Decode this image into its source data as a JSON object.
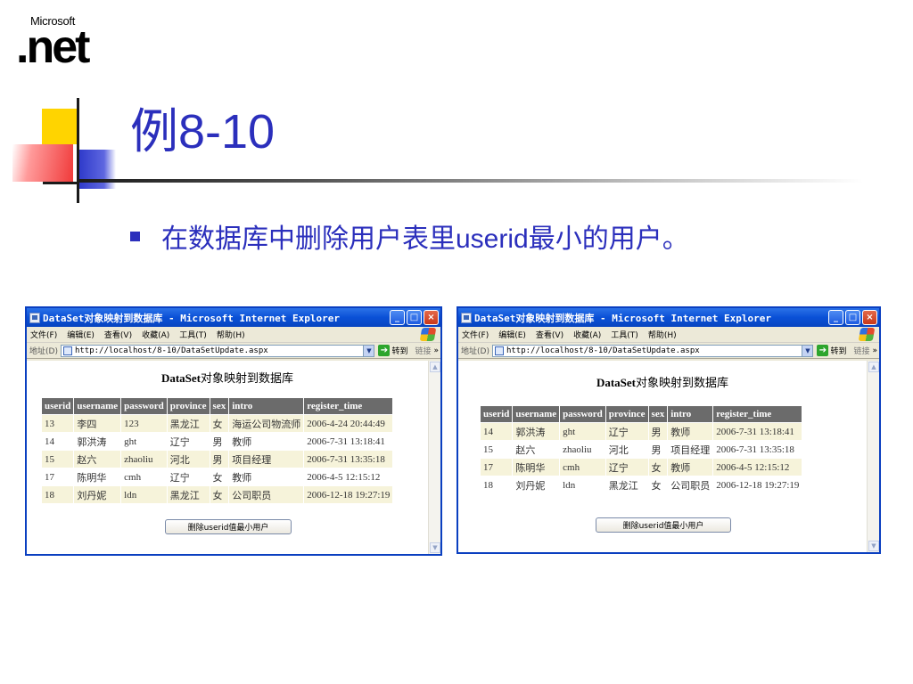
{
  "logo": {
    "company": "Microsoft",
    "product": ".net"
  },
  "slide": {
    "title": "例8-10",
    "bullet": "在数据库中删除用户表里userid最小的用户。"
  },
  "colors": {
    "title": "#2b2fbc",
    "table_header": "#6b6b6b",
    "row_alt": "#f6f3da",
    "xp_titlebar": "#0a50d6"
  },
  "browser": {
    "window_title": "DataSet对象映射到数据库 - Microsoft Internet Explorer",
    "menus": [
      "文件(F)",
      "编辑(E)",
      "查看(V)",
      "收藏(A)",
      "工具(T)",
      "帮助(H)"
    ],
    "address_label": "地址(D)",
    "url": "http://localhost/8-10/DataSetUpdate.aspx",
    "go_label": "转到",
    "links_label": "链接",
    "chevron": "»",
    "controls": {
      "minimize": "_",
      "maximize": "□",
      "close": "×"
    },
    "icons": [
      "ie-page-icon",
      "windows-logo-icon",
      "go-arrow-icon",
      "dropdown-arrow-icon",
      "scroll-up-icon",
      "scroll-down-icon"
    ]
  },
  "page": {
    "heading_bold": "DataSet",
    "heading_rest": "对象映射到数据库",
    "delete_button": "删除userid值最小用户",
    "columns": [
      "userid",
      "username",
      "password",
      "province",
      "sex",
      "intro",
      "register_time"
    ]
  },
  "before": {
    "rows": [
      [
        "13",
        "李四",
        "123",
        "黑龙江",
        "女",
        "海运公司物流师",
        "2006-4-24 20:44:49"
      ],
      [
        "14",
        "郭洪涛",
        "ght",
        "辽宁",
        "男",
        "教师",
        "2006-7-31 13:18:41"
      ],
      [
        "15",
        "赵六",
        "zhaoliu",
        "河北",
        "男",
        "项目经理",
        "2006-7-31 13:35:18"
      ],
      [
        "17",
        "陈明华",
        "cmh",
        "辽宁",
        "女",
        "教师",
        "2006-4-5 12:15:12"
      ],
      [
        "18",
        "刘丹妮",
        "ldn",
        "黑龙江",
        "女",
        "公司职员",
        "2006-12-18 19:27:19"
      ]
    ]
  },
  "after": {
    "rows": [
      [
        "14",
        "郭洪涛",
        "ght",
        "辽宁",
        "男",
        "教师",
        "2006-7-31 13:18:41"
      ],
      [
        "15",
        "赵六",
        "zhaoliu",
        "河北",
        "男",
        "项目经理",
        "2006-7-31 13:35:18"
      ],
      [
        "17",
        "陈明华",
        "cmh",
        "辽宁",
        "女",
        "教师",
        "2006-4-5 12:15:12"
      ],
      [
        "18",
        "刘丹妮",
        "ldn",
        "黑龙江",
        "女",
        "公司职员",
        "2006-12-18 19:27:19"
      ]
    ]
  }
}
